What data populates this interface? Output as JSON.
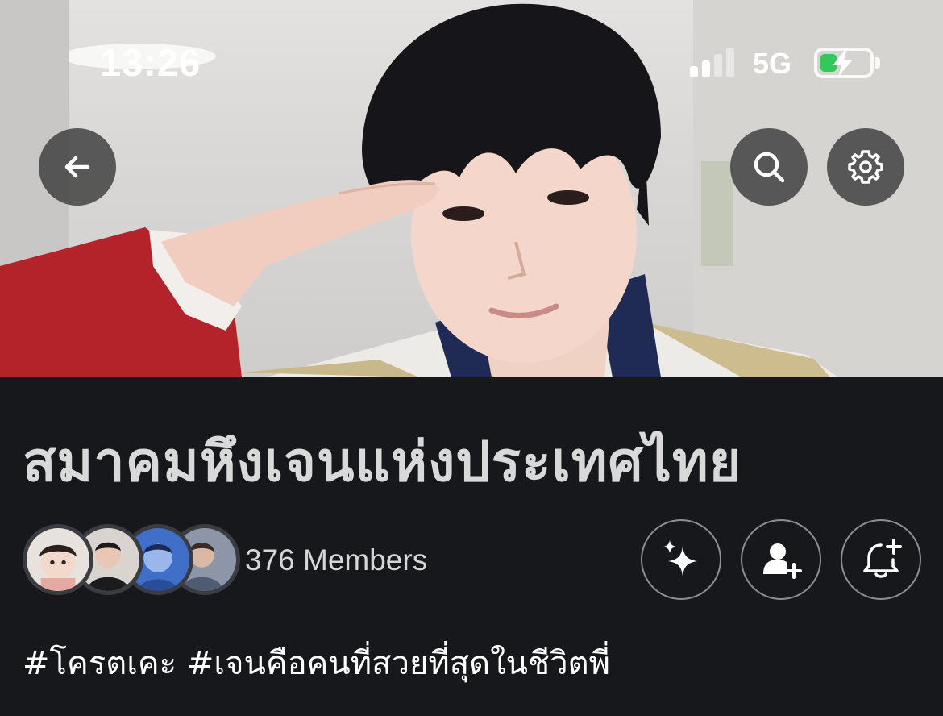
{
  "status_bar": {
    "time": "13:26",
    "network": "5G",
    "battery_color": "#34c759",
    "charging": true,
    "signal_bars_active": 2,
    "signal_bars_total": 4,
    "battery_level": 0.35
  },
  "header": {
    "back_icon": "arrow-left-icon",
    "search_icon": "search-icon",
    "settings_icon": "gear-icon"
  },
  "cover": {
    "description_icon": "cover-photo"
  },
  "group": {
    "title": "สมาคมหึงเจนแห่งประเทศไทย",
    "members_label": "376 Members",
    "hashtags": "#โครตเคะ #เจนคือคนที่สวยที่สุดในชีวิตพี่"
  },
  "actions": [
    {
      "icon": "sparkles-icon"
    },
    {
      "icon": "add-person-icon"
    },
    {
      "icon": "bell-plus-icon"
    }
  ],
  "colors": {
    "background": "#17181c",
    "title": "#d9d9d9",
    "button_border": "#8e8e93"
  }
}
